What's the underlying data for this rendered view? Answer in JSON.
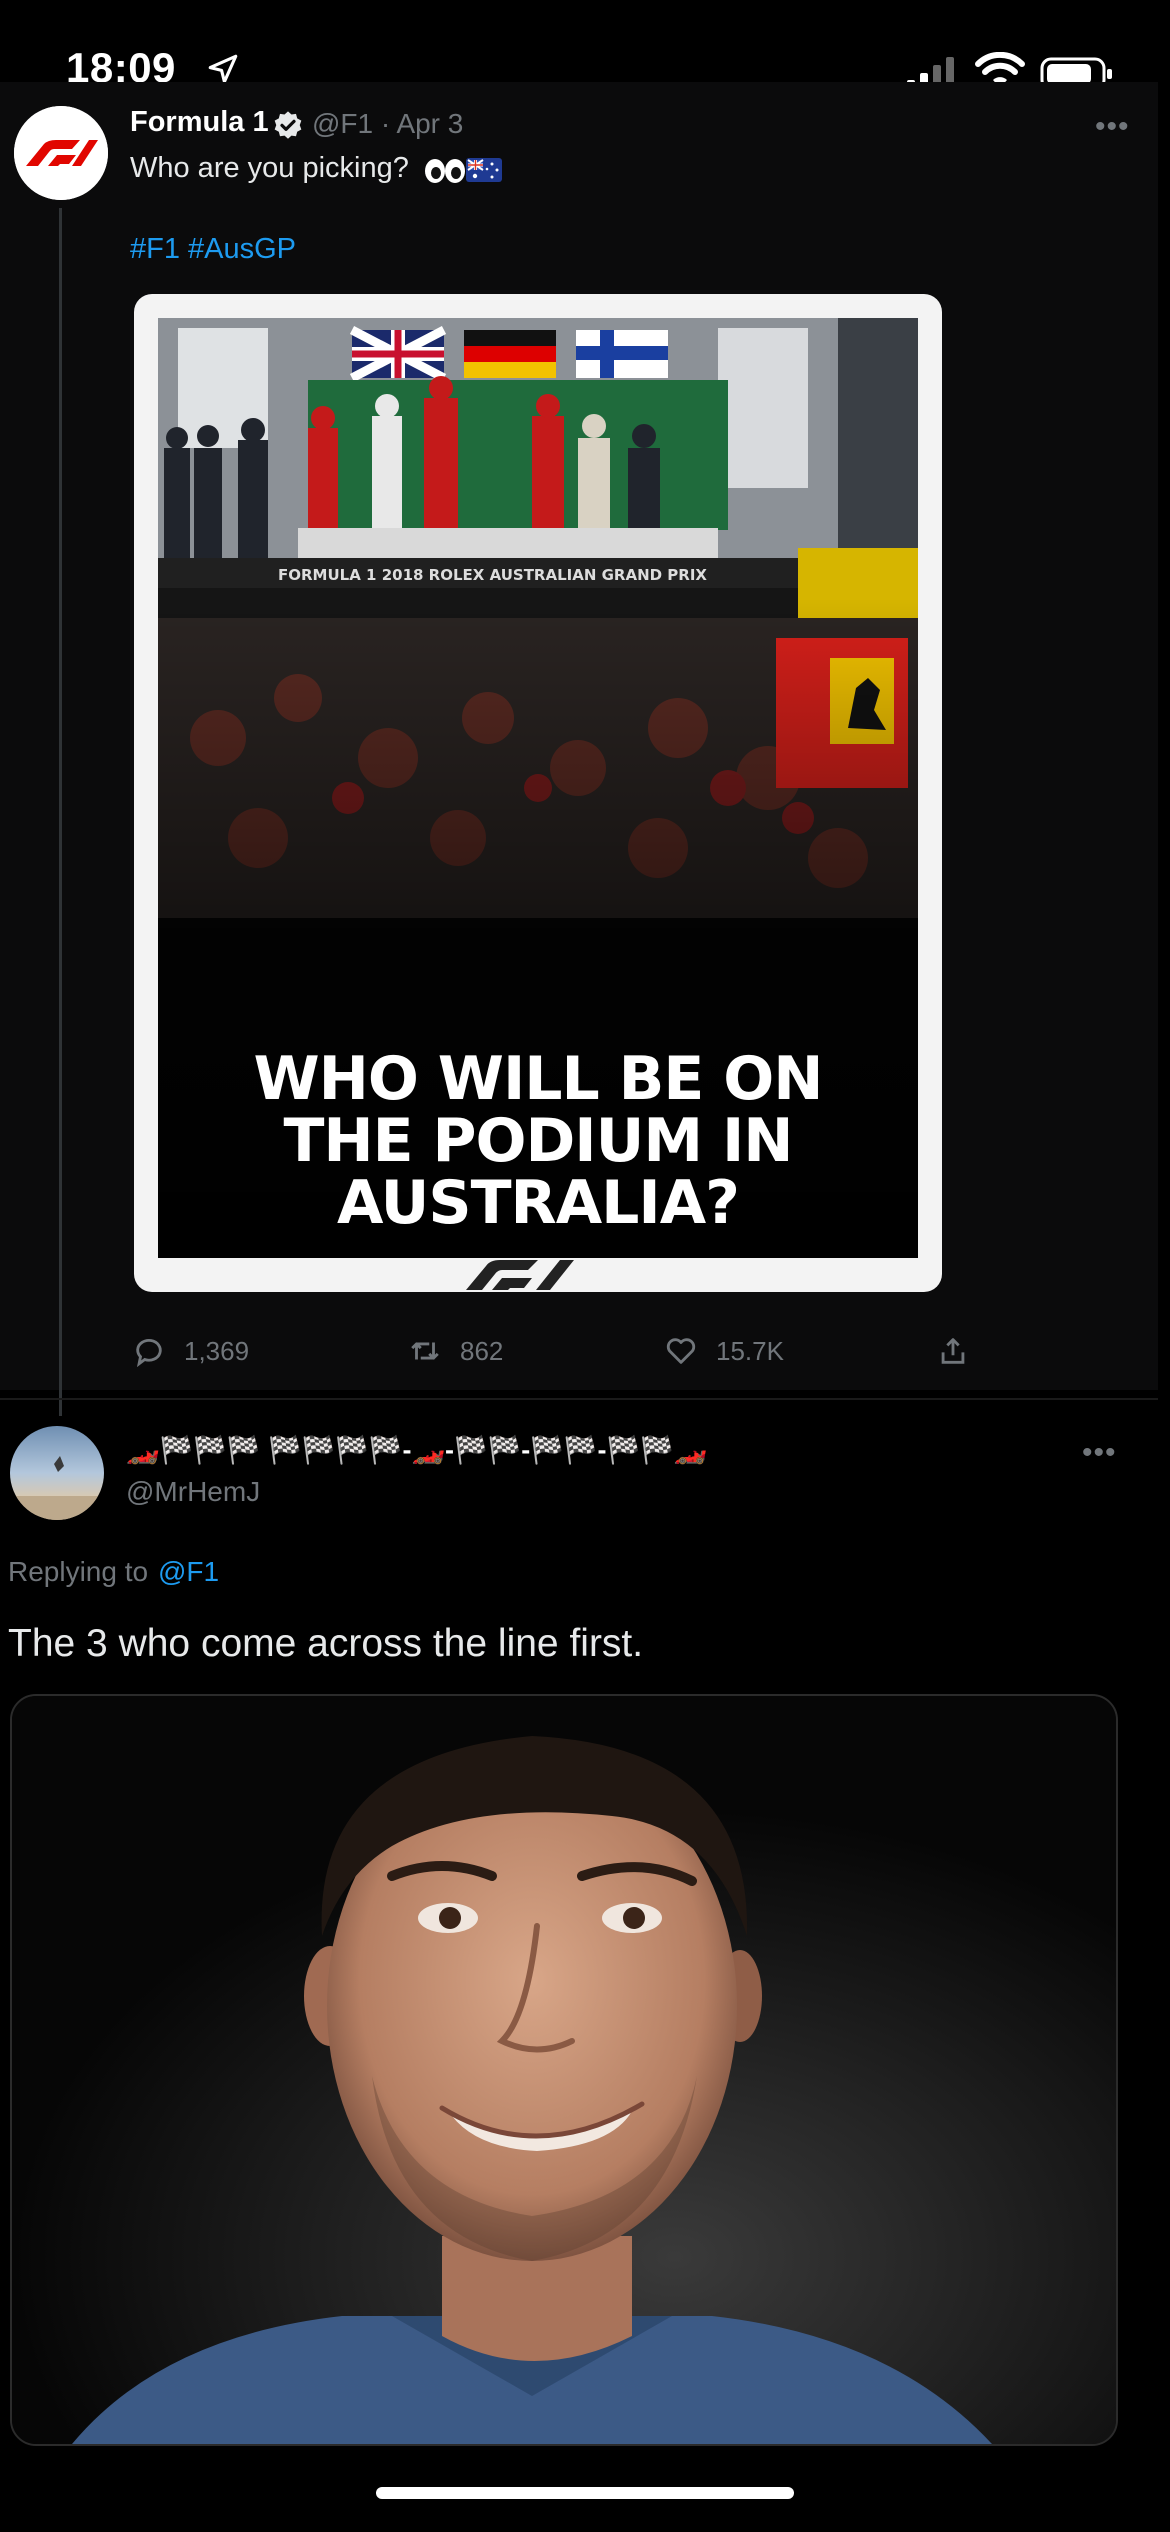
{
  "status_bar": {
    "time": "18:09"
  },
  "tweet1": {
    "author_name": "Formula 1",
    "meta": "@F1 · Apr 3",
    "text": "Who are you picking?",
    "hashtags": "#F1 #AusGP",
    "media": {
      "poster_lines": [
        "WHO WILL BE ON",
        "THE PODIUM IN",
        "AUSTRALIA?"
      ],
      "banner_text": "FORMULA 1 2018 ROLEX AUSTRALIAN GRAND PRIX"
    },
    "actions": {
      "replies": "1,369",
      "retweets": "862",
      "likes": "15.7K"
    }
  },
  "tweet2": {
    "author_name": "🏎️🏁🏁🏁 🏁🏁🏁🏁-🏎️-🏁🏁-🏁🏁-🏁🏁🏎️",
    "handle": "@MrHemJ",
    "replying_prefix": "Replying to",
    "replying_to": "@F1",
    "text": "The 3 who come across the line first."
  },
  "colors": {
    "link": "#1d9bf0",
    "f1_red": "#e10600",
    "muted": "#71767b"
  }
}
